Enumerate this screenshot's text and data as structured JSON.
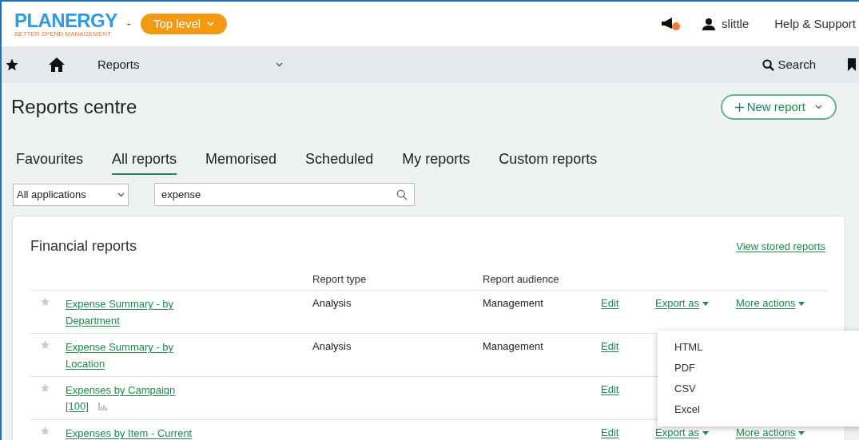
{
  "header": {
    "logo": "PLANERGY",
    "tagline": "BETTER SPEND MANAGEMENT",
    "separator": "-",
    "level_button": "Top level",
    "user": "slittle",
    "help": "Help & Support"
  },
  "nav": {
    "section": "Reports",
    "search": "Search"
  },
  "page": {
    "title": "Reports centre",
    "new_button": "New report"
  },
  "tabs": [
    {
      "label": "Favourites",
      "selected": false
    },
    {
      "label": "All reports",
      "selected": true
    },
    {
      "label": "Memorised",
      "selected": false
    },
    {
      "label": "Scheduled",
      "selected": false
    },
    {
      "label": "My reports",
      "selected": false
    },
    {
      "label": "Custom reports",
      "selected": false
    }
  ],
  "filters": {
    "application": "All applications",
    "search_value": "expense"
  },
  "card": {
    "title": "Financial reports",
    "stored_link": "View stored reports",
    "columns": [
      "Report type",
      "Report audience"
    ],
    "rows": [
      {
        "name": "Expense Summary - by Department",
        "type": "Analysis",
        "audience": "Management",
        "edit": "Edit",
        "export": "Export as",
        "more": "More actions"
      },
      {
        "name": "Expense Summary - by Location",
        "type": "Analysis",
        "audience": "Management",
        "edit": "Edit"
      },
      {
        "name": "Expenses by Campaign",
        "count": "[100]",
        "edit": "Edit"
      },
      {
        "name": "Expenses by Item - Current",
        "edit": "Edit",
        "export": "Export as",
        "more": "More actions"
      }
    ]
  },
  "export_menu": [
    "HTML",
    "PDF",
    "CSV",
    "Excel"
  ]
}
